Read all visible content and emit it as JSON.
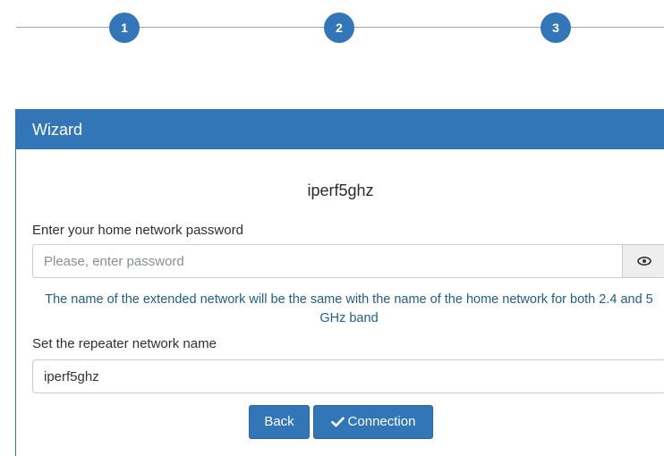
{
  "stepper": {
    "steps": [
      "1",
      "2",
      "3"
    ]
  },
  "panel": {
    "title": "Wizard",
    "network_name": "iperf5ghz",
    "password_label": "Enter your home network password",
    "password_placeholder": "Please, enter password",
    "password_value": "",
    "info_text": "The name of the extended network will be the same with the name of the home network for both 2.4 and 5 GHz band",
    "repeater_label": "Set the repeater network name",
    "repeater_value": "iperf5ghz",
    "back_label": "Back",
    "connection_label": "Connection"
  },
  "icons": {
    "password_toggle": "eye-icon",
    "connection": "check-icon"
  },
  "colors": {
    "primary": "#3276b8",
    "info_text": "#1f5e8e"
  }
}
